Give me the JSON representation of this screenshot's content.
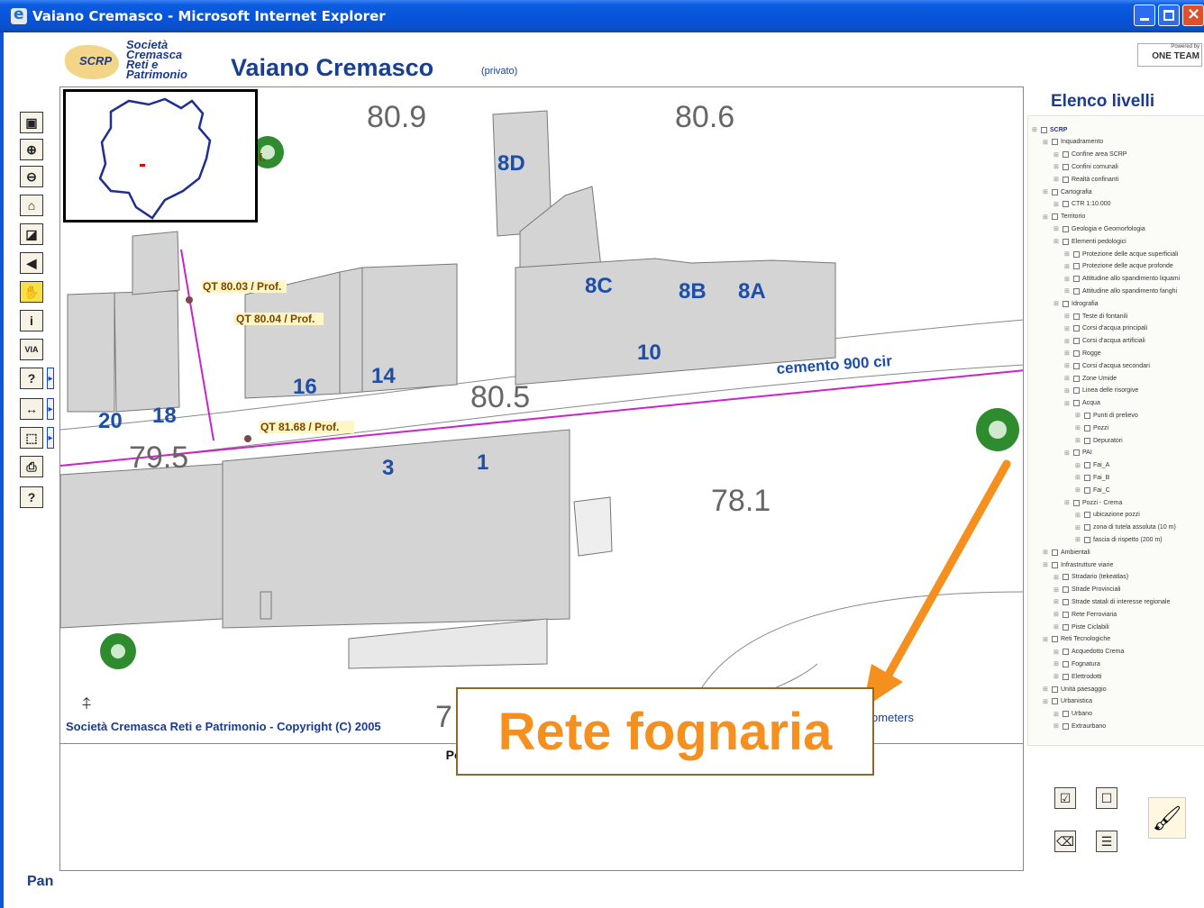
{
  "window": {
    "title": "Vaiano Cremasco - Microsoft Internet Explorer"
  },
  "header": {
    "logo_abbr": "SCRP",
    "logo_name_lines": [
      "Società",
      "Cremasca",
      "Reti e",
      "Patrimonio"
    ],
    "title": "Vaiano Cremasco",
    "subtitle": "(privato)",
    "powered_small": "Powered by",
    "powered_brand": "ONE TEAM"
  },
  "map": {
    "copyright": "Società Cremasca Reti e Patrimonio - Copyright (C) 2005",
    "scale_text": "ometers",
    "heights": [
      "80.9",
      "80.6",
      "80.5",
      "79.5",
      "78.1",
      "7"
    ],
    "building_numbers": [
      "8D",
      "8C",
      "8B",
      "8A",
      "10",
      "16",
      "14",
      "20",
      "18",
      "3",
      "1"
    ],
    "pipe_labels": [
      "QT 80.03 / Prof.",
      "QT 80.04 / Prof.",
      "QT 81.68 / Prof."
    ],
    "pipe_tag_fragment": "f.",
    "pipe_material": "cemento 900 cir"
  },
  "status": {
    "message": "Pozzetti adesso è il Layer Attivo",
    "mode": "Pan"
  },
  "callout": {
    "text": "Rete fognaria",
    "color": "#f5901e"
  },
  "layers_panel": {
    "title": "Elenco livelli",
    "items": [
      {
        "label": "SCRP",
        "indent": 0
      },
      {
        "label": "Inquadramento",
        "indent": 1
      },
      {
        "label": "Confine area SCRP",
        "indent": 2
      },
      {
        "label": "Confini comunali",
        "indent": 2
      },
      {
        "label": "Realtà confinanti",
        "indent": 2
      },
      {
        "label": "Cartografia",
        "indent": 1
      },
      {
        "label": "CTR 1:10.000",
        "indent": 2
      },
      {
        "label": "Territorio",
        "indent": 1
      },
      {
        "label": "Geologia e Geomorfologia",
        "indent": 2
      },
      {
        "label": "Elementi pedologici",
        "indent": 2
      },
      {
        "label": "Protezione delle acque superficiali",
        "indent": 3
      },
      {
        "label": "Protezione delle acque profonde",
        "indent": 3
      },
      {
        "label": "Attitudine allo spandimento liquami",
        "indent": 3
      },
      {
        "label": "Attitudine allo spandimento fanghi",
        "indent": 3
      },
      {
        "label": "Idrografia",
        "indent": 2
      },
      {
        "label": "Teste di fontanili",
        "indent": 3
      },
      {
        "label": "Corsi d'acqua principali",
        "indent": 3
      },
      {
        "label": "Corsi d'acqua artificiali",
        "indent": 3
      },
      {
        "label": "Rogge",
        "indent": 3
      },
      {
        "label": "Corsi d'acqua secondari",
        "indent": 3
      },
      {
        "label": "Zone Umide",
        "indent": 3
      },
      {
        "label": "Linea delle risorgive",
        "indent": 3
      },
      {
        "label": "Acqua",
        "indent": 3
      },
      {
        "label": "Punti di prelievo",
        "indent": 4
      },
      {
        "label": "Pozzi",
        "indent": 4
      },
      {
        "label": "Depuratori",
        "indent": 4
      },
      {
        "label": "PAI",
        "indent": 3
      },
      {
        "label": "Fai_A",
        "indent": 4
      },
      {
        "label": "Fai_B",
        "indent": 4
      },
      {
        "label": "Fai_C",
        "indent": 4
      },
      {
        "label": "Pozzi - Crema",
        "indent": 3
      },
      {
        "label": "ubicazione pozzi",
        "indent": 4
      },
      {
        "label": "zona di tutela assoluta (10 m)",
        "indent": 4
      },
      {
        "label": "fascia di rispetto (200 m)",
        "indent": 4
      },
      {
        "label": "Ambientali",
        "indent": 1
      },
      {
        "label": "Infrastrutture viarie",
        "indent": 1
      },
      {
        "label": "Stradario (tekeatlas)",
        "indent": 2
      },
      {
        "label": "Strade Provinciali",
        "indent": 2
      },
      {
        "label": "Strade statali di interesse regionale",
        "indent": 2
      },
      {
        "label": "Rete Ferroviaria",
        "indent": 2
      },
      {
        "label": "Piste Ciclabili",
        "indent": 2
      },
      {
        "label": "Reti Tecnologiche",
        "indent": 1
      },
      {
        "label": "Acquedotto Crema",
        "indent": 2
      },
      {
        "label": "Fognatura",
        "indent": 2
      },
      {
        "label": "Elettrodotti",
        "indent": 2
      },
      {
        "label": "Unità paesaggio",
        "indent": 1
      },
      {
        "label": "Urbanistica",
        "indent": 1
      },
      {
        "label": "Urbano",
        "indent": 2
      },
      {
        "label": "Extraurbano",
        "indent": 2
      }
    ]
  },
  "tools": [
    {
      "name": "layers-toggle-tool",
      "glyph": "▣"
    },
    {
      "name": "zoom-in-tool",
      "glyph": "⊕"
    },
    {
      "name": "zoom-out-tool",
      "glyph": "⊖"
    },
    {
      "name": "zoom-full-tool",
      "glyph": "⌂"
    },
    {
      "name": "zoom-layer-tool",
      "glyph": "◪"
    },
    {
      "name": "back-tool",
      "glyph": "◀"
    },
    {
      "name": "pan-tool",
      "glyph": "✋"
    },
    {
      "name": "info-tool",
      "glyph": "i"
    },
    {
      "name": "via-tool",
      "glyph": "VIA"
    },
    {
      "name": "query-tool",
      "glyph": "?"
    },
    {
      "name": "measure-tool",
      "glyph": "↔"
    },
    {
      "name": "select-tool",
      "glyph": "⬚"
    },
    {
      "name": "print-tool",
      "glyph": "⎙"
    },
    {
      "name": "help-tool",
      "glyph": "?"
    }
  ],
  "colors": {
    "pipe": "#cc22cc",
    "building": "#d4d4d4",
    "number_blue": "#1d4ea8",
    "height_gray": "#666666",
    "tree_green": "#2e8b2e",
    "arrow": "#f5901e"
  }
}
